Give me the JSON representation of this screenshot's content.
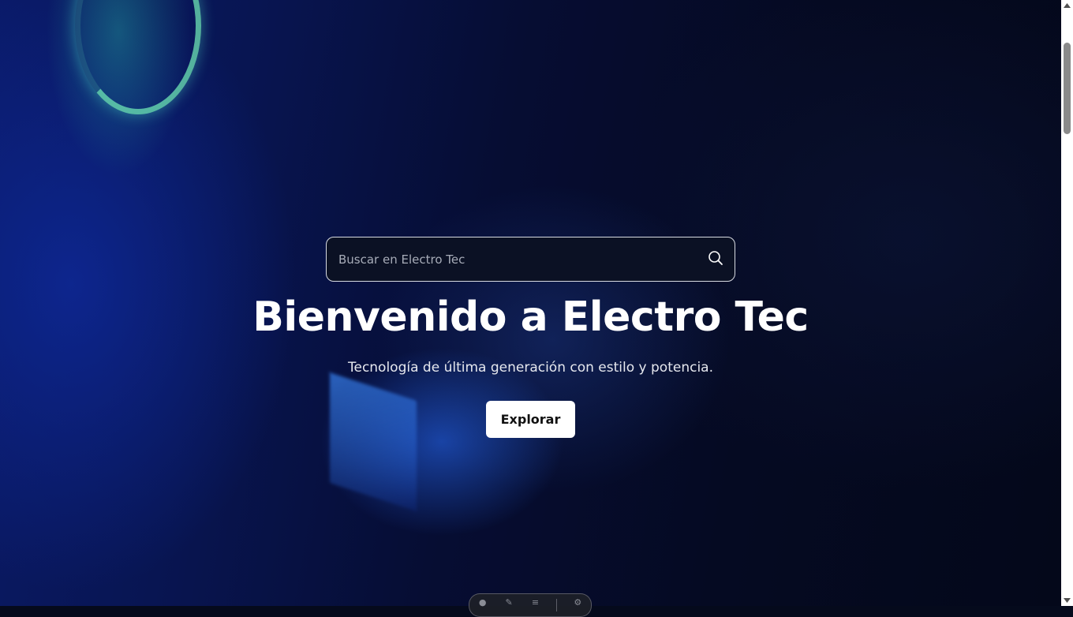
{
  "search": {
    "placeholder": "Buscar en Electro Tec",
    "icon": "search-icon"
  },
  "hero": {
    "title": "Bienvenido a Electro Tec",
    "subtitle": "Tecnología de última generación con estilo y potencia.",
    "cta_label": "Explorar"
  },
  "dock": {
    "icons": [
      "person-icon",
      "brush-icon",
      "menu-icon",
      "gear-icon"
    ]
  },
  "colors": {
    "background": "#050a1c",
    "accent_blue": "#1a3cd0",
    "button_bg": "#ffffff",
    "text": "#ffffff"
  }
}
